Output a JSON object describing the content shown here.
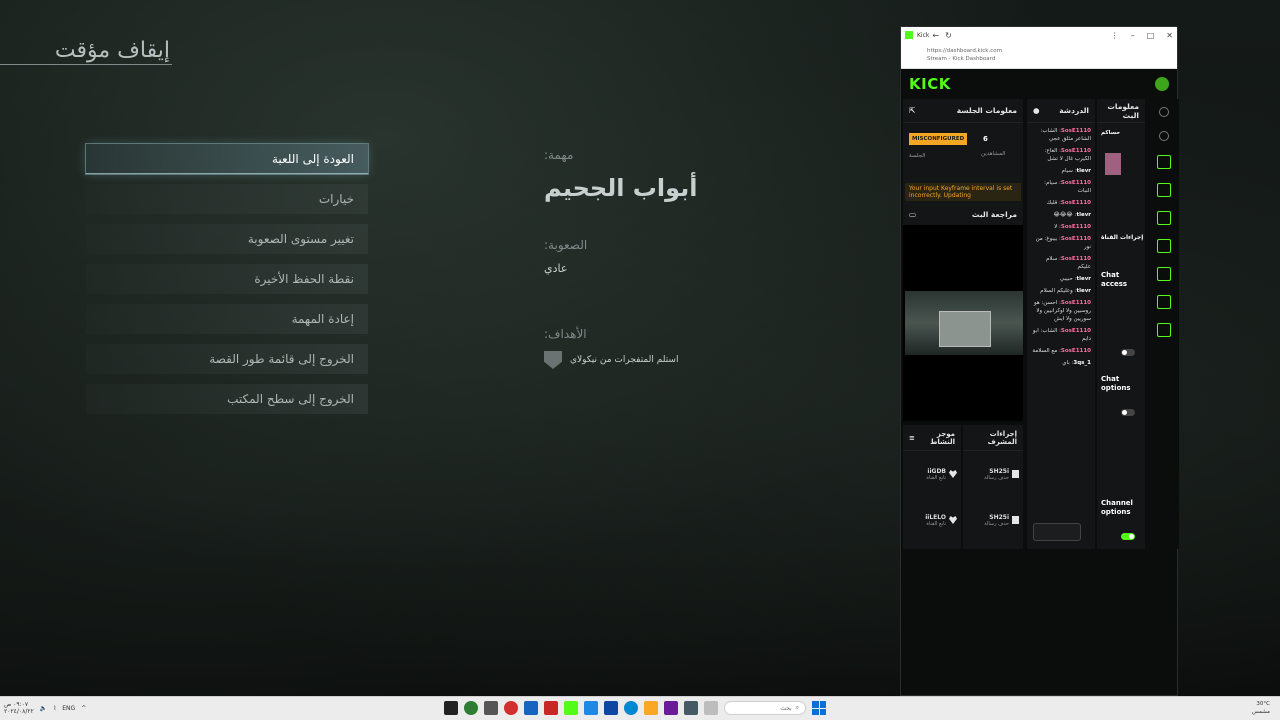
{
  "game": {
    "pause_title": "إيقاف مؤقت",
    "menu": [
      "العودة إلى اللعبة",
      "خيارات",
      "تغيير مستوى الصعوبة",
      "نقطة الحفظ الأخيرة",
      "إعادة المهمة",
      "الخروج إلى قائمة طور القصة",
      "الخروج إلى سطح المكتب"
    ],
    "mission_label": "مهمة:",
    "mission_name": "أبواب الجحيم",
    "difficulty_label": "الصعوبة:",
    "difficulty": "عادي",
    "goals_label": "الأهداف:",
    "goal": "استلم المتفجرات من نيكولاي"
  },
  "browser": {
    "tab_title": "Kick",
    "url": "https://dashboard.kick.com",
    "page_title": "Stream - Kick Dashboard",
    "logo": "KICK",
    "session": {
      "header": "معلومات الجلسة",
      "badge": "MISCONFIGURED",
      "session_label": "الجلسة",
      "viewers_count": "6",
      "viewers_label": "المشاهدين",
      "warning": "Your input Keyframe interval is set incorrectly. Updating"
    },
    "preview_header": "مراجعة البث",
    "chat": {
      "header": "الدردشة",
      "messages": [
        {
          "user": "SosE1110",
          "text": "الشاب: الشاعر مثلق عجي"
        },
        {
          "user": "SosE1110",
          "text": "الغاع: الكيرب غال لا تشل"
        },
        {
          "user": "tlevr",
          "text": "سيام"
        },
        {
          "user": "SosE1110",
          "text": "سيام: النبات"
        },
        {
          "user": "SosE1110",
          "text": "قلبك"
        },
        {
          "user": "tlevr",
          "text": "😂😂😂"
        },
        {
          "user": "SosE1110",
          "text": "لا"
        },
        {
          "user": "SosE1110",
          "text": "بيبوغ: من نور"
        },
        {
          "user": "SosE1110",
          "text": "سلام عليكم"
        },
        {
          "user": "tlevr",
          "text": "حبيبي"
        },
        {
          "user": "tlevr",
          "text": "وعليكم السلام"
        },
        {
          "user": "SosE1110",
          "text": "احسن: هو روسيين ولا اوكرانيين ولا سوريين ولا ايش"
        },
        {
          "user": "SosE1110",
          "text": "الشاب: ابو دايم"
        },
        {
          "user": "SosE1110",
          "text": "مع السلامة"
        },
        {
          "user": "3qs_1",
          "text": "باي"
        }
      ]
    },
    "channel": {
      "header": "معلومات البث",
      "broadcaster_label": "حساكم",
      "channel_actions": "إجراءات القناة",
      "chat_access": "Chat access",
      "chat_options": "Chat options",
      "channel_options": "Channel options"
    },
    "mod_actions": {
      "header": "إجراءات المشرف",
      "rows": [
        {
          "user": "SH25i",
          "sub": "حذف رسالة"
        },
        {
          "user": "SH25i",
          "sub": "حذف رسالة"
        }
      ]
    },
    "recent": {
      "header": "موجز النشاط",
      "rows": [
        {
          "user": "iiGDB",
          "sub": "تابع القناة"
        },
        {
          "user": "iiLELO",
          "sub": "تابع القناة"
        }
      ]
    }
  },
  "taskbar": {
    "search_placeholder": "بحث",
    "lang": "ENG",
    "weather": "30°C",
    "weather_sub": "مشمس",
    "time": "٠٩:٠٧ ص",
    "date": "٢٠٢٤/٠٨/٢٢"
  }
}
